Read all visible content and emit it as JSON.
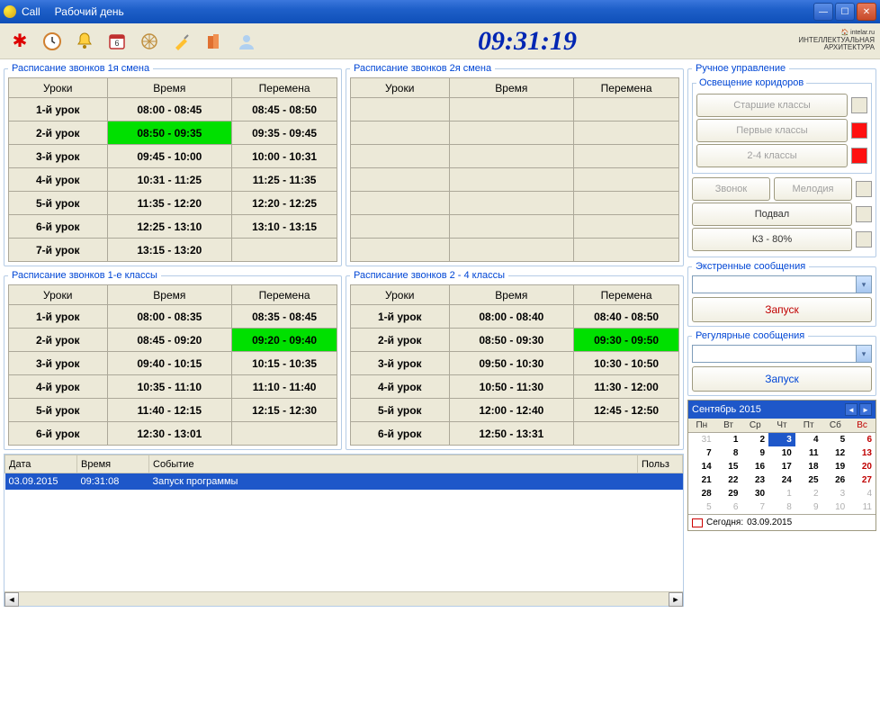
{
  "titlebar": {
    "app": "Call",
    "mode": "Рабочий день"
  },
  "clock": "09:31:19",
  "logo": {
    "line1": "intelar.ru",
    "line2": "ИНТЕЛЛЕКТУАЛЬНАЯ",
    "line3": "АРХИТЕКТУРА"
  },
  "schedules": {
    "shift1": {
      "title": "Расписание звонков 1я смена",
      "headers": [
        "Уроки",
        "Время",
        "Перемена"
      ],
      "rows": [
        {
          "lesson": "1-й урок",
          "time": "08:00 - 08:45",
          "break": "08:45 - 08:50"
        },
        {
          "lesson": "2-й урок",
          "time": "08:50 - 09:35",
          "break": "09:35 - 09:45",
          "hl_time": true
        },
        {
          "lesson": "3-й урок",
          "time": "09:45 - 10:00",
          "break": "10:00 - 10:31"
        },
        {
          "lesson": "4-й урок",
          "time": "10:31 - 11:25",
          "break": "11:25 - 11:35"
        },
        {
          "lesson": "5-й урок",
          "time": "11:35 - 12:20",
          "break": "12:20 - 12:25"
        },
        {
          "lesson": "6-й урок",
          "time": "12:25 - 13:10",
          "break": "13:10 - 13:15"
        },
        {
          "lesson": "7-й урок",
          "time": "13:15 - 13:20",
          "break": ""
        }
      ]
    },
    "shift2": {
      "title": "Расписание звонков 2я смена",
      "headers": [
        "Уроки",
        "Время",
        "Перемена"
      ],
      "rows": [
        {},
        {},
        {},
        {},
        {},
        {},
        {}
      ]
    },
    "class1": {
      "title": "Расписание звонков 1-е классы",
      "headers": [
        "Уроки",
        "Время",
        "Перемена"
      ],
      "rows": [
        {
          "lesson": "1-й урок",
          "time": "08:00 - 08:35",
          "break": "08:35 - 08:45"
        },
        {
          "lesson": "2-й урок",
          "time": "08:45 - 09:20",
          "break": "09:20 - 09:40",
          "hl_break": true
        },
        {
          "lesson": "3-й урок",
          "time": "09:40 - 10:15",
          "break": "10:15 - 10:35"
        },
        {
          "lesson": "4-й урок",
          "time": "10:35 - 11:10",
          "break": "11:10 - 11:40"
        },
        {
          "lesson": "5-й урок",
          "time": "11:40 - 12:15",
          "break": "12:15 - 12:30"
        },
        {
          "lesson": "6-й урок",
          "time": "12:30 - 13:01",
          "break": ""
        }
      ]
    },
    "class24": {
      "title": "Расписание звонков 2 - 4 классы",
      "headers": [
        "Уроки",
        "Время",
        "Перемена"
      ],
      "rows": [
        {
          "lesson": "1-й урок",
          "time": "08:00 - 08:40",
          "break": "08:40 - 08:50"
        },
        {
          "lesson": "2-й урок",
          "time": "08:50 - 09:30",
          "break": "09:30 - 09:50",
          "hl_break": true
        },
        {
          "lesson": "3-й урок",
          "time": "09:50 - 10:30",
          "break": "10:30 - 10:50"
        },
        {
          "lesson": "4-й урок",
          "time": "10:50 - 11:30",
          "break": "11:30 - 12:00"
        },
        {
          "lesson": "5-й урок",
          "time": "12:00 - 12:40",
          "break": "12:45 - 12:50"
        },
        {
          "lesson": "6-й урок",
          "time": "12:50 - 13:31",
          "break": ""
        }
      ]
    }
  },
  "events": {
    "headers": [
      "Дата",
      "Время",
      "Событие",
      "Польз"
    ],
    "rows": [
      {
        "date": "03.09.2015",
        "time": "09:31:08",
        "event": "Запуск программы",
        "user": ""
      }
    ]
  },
  "manual": {
    "title": "Ручное управление",
    "lighting": {
      "title": "Освещение коридоров",
      "senior": "Старшие классы",
      "first": "Первые классы",
      "cl24": "2-4 классы"
    },
    "bell": "Звонок",
    "melody": "Мелодия",
    "basement": "Подвал",
    "k3": "К3 - 80%"
  },
  "emergency": {
    "title": "Экстренные сообщения",
    "launch": "Запуск"
  },
  "regular": {
    "title": "Регулярные сообщения",
    "launch": "Запуск"
  },
  "calendar": {
    "month": "Сентябрь 2015",
    "days": [
      "Пн",
      "Вт",
      "Ср",
      "Чт",
      "Пт",
      "Сб",
      "Вс"
    ],
    "weeks": [
      [
        {
          "d": 31,
          "g": 1
        },
        {
          "d": 1
        },
        {
          "d": 2
        },
        {
          "d": 3,
          "t": 1
        },
        {
          "d": 4
        },
        {
          "d": 5
        },
        {
          "d": 6,
          "s": 1
        }
      ],
      [
        {
          "d": 7
        },
        {
          "d": 8
        },
        {
          "d": 9
        },
        {
          "d": 10
        },
        {
          "d": 11
        },
        {
          "d": 12
        },
        {
          "d": 13,
          "s": 1
        }
      ],
      [
        {
          "d": 14
        },
        {
          "d": 15
        },
        {
          "d": 16
        },
        {
          "d": 17
        },
        {
          "d": 18
        },
        {
          "d": 19
        },
        {
          "d": 20,
          "s": 1
        }
      ],
      [
        {
          "d": 21
        },
        {
          "d": 22
        },
        {
          "d": 23
        },
        {
          "d": 24
        },
        {
          "d": 25
        },
        {
          "d": 26
        },
        {
          "d": 27,
          "s": 1
        }
      ],
      [
        {
          "d": 28
        },
        {
          "d": 29
        },
        {
          "d": 30
        },
        {
          "d": 1,
          "g": 1
        },
        {
          "d": 2,
          "g": 1
        },
        {
          "d": 3,
          "g": 1
        },
        {
          "d": 4,
          "g": 1
        }
      ],
      [
        {
          "d": 5,
          "g": 1
        },
        {
          "d": 6,
          "g": 1
        },
        {
          "d": 7,
          "g": 1
        },
        {
          "d": 8,
          "g": 1
        },
        {
          "d": 9,
          "g": 1
        },
        {
          "d": 10,
          "g": 1
        },
        {
          "d": 11,
          "g": 1
        }
      ]
    ],
    "today_label": "Сегодня:",
    "today_date": "03.09.2015"
  }
}
